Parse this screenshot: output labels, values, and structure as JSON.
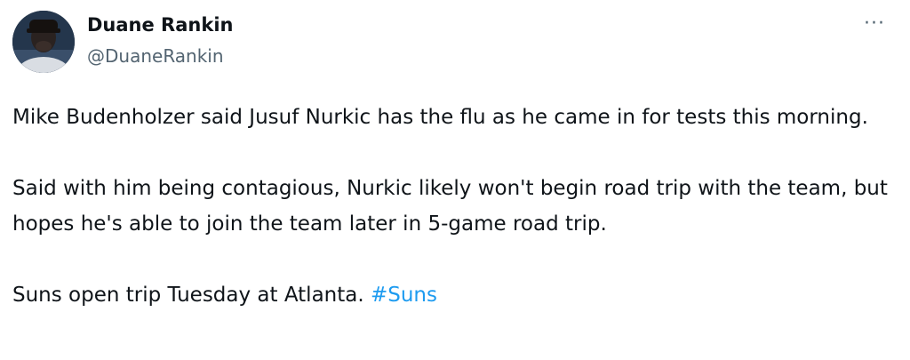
{
  "author": {
    "display_name": "Duane Rankin",
    "handle": "@DuaneRankin",
    "avatar_icon": "avatar-photo"
  },
  "menu": {
    "icon": "more-options-icon",
    "glyph": "···"
  },
  "tweet": {
    "paragraphs": [
      "Mike Budenholzer said Jusuf Nurkic has the flu as he came in for tests this morning.",
      "Said with him being contagious, Nurkic likely won't begin road trip with the team, but hopes he's able to join the team later in 5-game road trip."
    ],
    "last_paragraph_text": "Suns open trip Tuesday at Atlanta. ",
    "hashtag": "#Suns"
  },
  "colors": {
    "text": "#0f1419",
    "secondary": "#536471",
    "link": "#1d9bf0",
    "background": "#ffffff"
  }
}
